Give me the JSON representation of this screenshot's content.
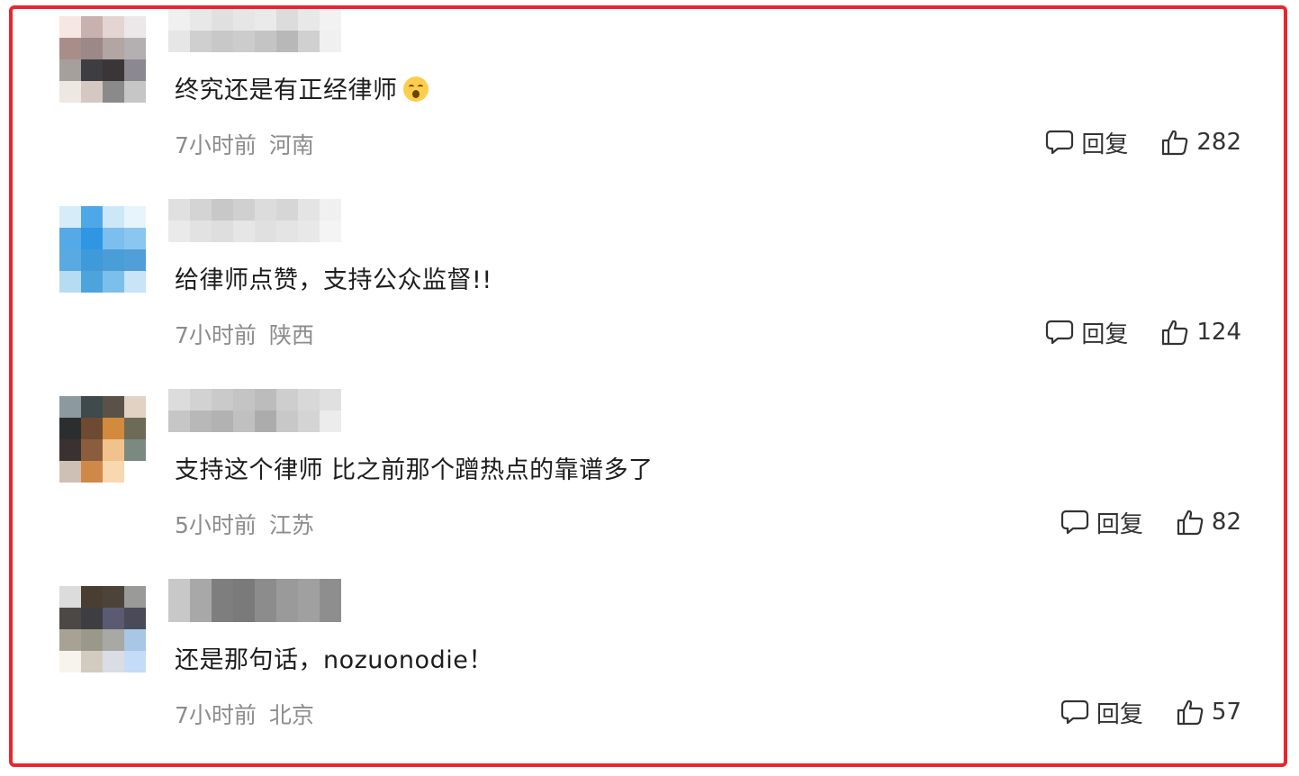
{
  "reply_label": "回复",
  "comments": [
    {
      "text": "终究还是有正经律师",
      "emoji": "flushed-face",
      "time": "7小时前",
      "location": "河南",
      "likes": "282",
      "avatar_colors": [
        "#f6e7e4",
        "#c8b1ae",
        "#e4d4d2",
        "#ece8ea",
        "#a98d89",
        "#9c8886",
        "#b2a5a4",
        "#b4b0b1",
        "#a6a09c",
        "#3e3d42",
        "#3a3638",
        "#8c8891",
        "#eee8e2",
        "#d5c7c2",
        "#8a8a8a",
        "#c6c6c6"
      ],
      "username_colors": [
        "#f0f0f0",
        "#e8e8e8",
        "#e0e0e0",
        "#e6e6e6",
        "#eaeaea",
        "#dcdcdc",
        "#e8e8e8",
        "#f2f2f2",
        "#e6e6e6",
        "#cfcfcf",
        "#c8c8c8",
        "#cccccc",
        "#c4c4c4",
        "#b8b8b8",
        "#d0d0d0",
        "#f0f0f0"
      ]
    },
    {
      "text": "给律师点赞，支持公众监督!!",
      "emoji": "",
      "time": "7小时前",
      "location": "陕西",
      "likes": "124",
      "avatar_colors": [
        "#d6ecf8",
        "#4ea8e8",
        "#cce8f8",
        "#e8f4fc",
        "#55a9e6",
        "#2f96e4",
        "#7cbfee",
        "#8ac6ef",
        "#5aaae2",
        "#3e9ad8",
        "#4a9ed8",
        "#509fd8",
        "#b6dcf4",
        "#4ea3dc",
        "#7cbfea",
        "#c8e4f6"
      ],
      "username_colors": [
        "#e0e0e0",
        "#d4d4d4",
        "#c8c8c8",
        "#d0d0d0",
        "#dcdcdc",
        "#d6d6d6",
        "#e4e4e4",
        "#f0f0f0",
        "#eaeaea",
        "#e2e2e2",
        "#dedede",
        "#e6e6e6",
        "#e0e0e0",
        "#e4e4e4",
        "#e8e8e8",
        "#f4f4f4"
      ]
    },
    {
      "text": "支持这个律师 比之前那个蹭热点的靠谱多了",
      "emoji": "",
      "time": "5小时前",
      "location": "江苏",
      "likes": "82",
      "avatar_colors": [
        "#8c9aa0",
        "#3e4a4c",
        "#5a5248",
        "#e2d2c4",
        "#2a2e2e",
        "#6e4a32",
        "#d28a3c",
        "#6e6a58",
        "#3a3230",
        "#8a5e3c",
        "#f2c28c",
        "#7a8a80",
        "#cfc0b6",
        "#d08848",
        "#f8d8b0",
        "#ffffff"
      ],
      "username_colors": [
        "#dcdcdc",
        "#d2d2d2",
        "#cacaca",
        "#c4c4c4",
        "#bcbcbc",
        "#cecece",
        "#d8d8d8",
        "#e0e0e0",
        "#c6c6c6",
        "#b8b8b8",
        "#b2b2b2",
        "#c0c0c0",
        "#acacac",
        "#c8c8c8",
        "#d4d4d4",
        "#ececec"
      ]
    },
    {
      "text": "还是那句话，nozuonodie！",
      "emoji": "",
      "time": "7小时前",
      "location": "北京",
      "likes": "57",
      "avatar_colors": [
        "#dcdcdc",
        "#4a3e32",
        "#4c4438",
        "#9a9a98",
        "#4c4846",
        "#3e3e42",
        "#5a5a72",
        "#4a4a58",
        "#a8a294",
        "#9a9888",
        "#a8a8a4",
        "#a8c6e6",
        "#f6f4ec",
        "#d2ccc0",
        "#dadde4",
        "#c4dcf8"
      ],
      "username_colors": [
        "#c8c8c8",
        "#a8a8a8",
        "#7e7e7e",
        "#7a7a7a",
        "#8c8c8c",
        "#9a9a9a",
        "#a0a0a0",
        "#8e8e8e",
        "#c8c8c8",
        "#a8a8a8",
        "#7e7e7e",
        "#7a7a7a",
        "#8c8c8c",
        "#9a9a9a",
        "#a0a0a0",
        "#8e8e8e"
      ]
    }
  ]
}
